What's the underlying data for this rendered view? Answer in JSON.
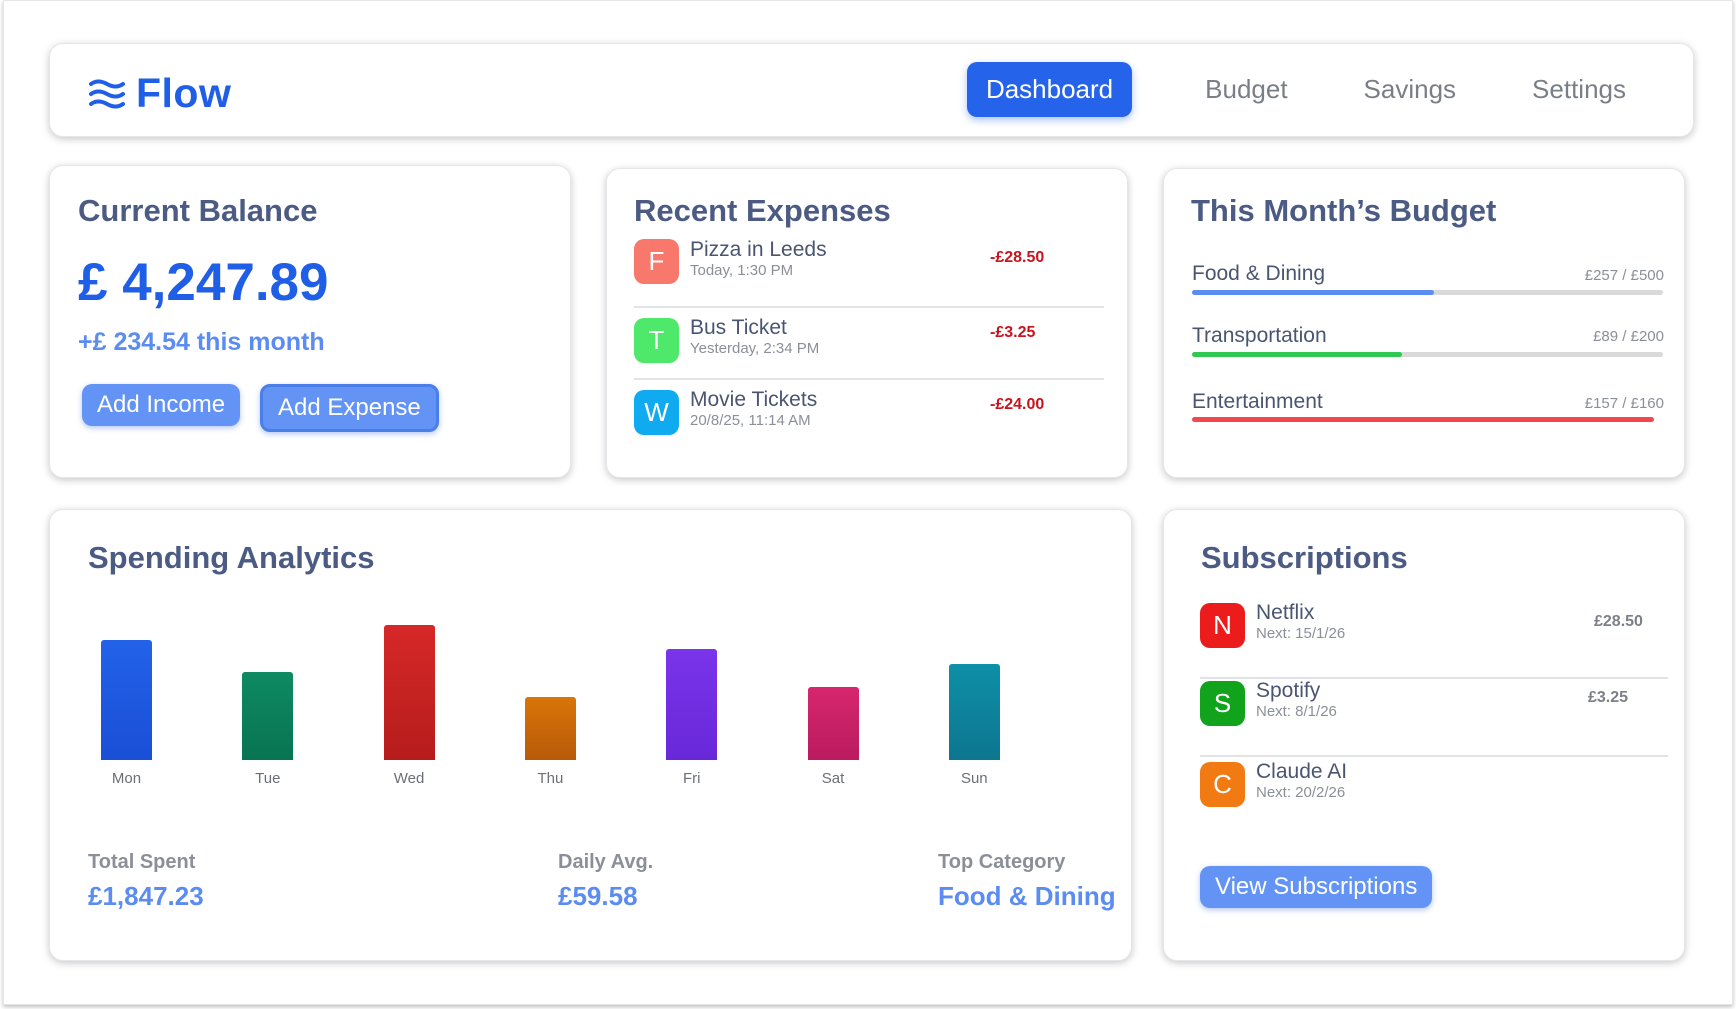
{
  "app": {
    "name": "Flow"
  },
  "nav": {
    "items": [
      {
        "label": "Dashboard",
        "active": true
      },
      {
        "label": "Budget",
        "active": false
      },
      {
        "label": "Savings",
        "active": false
      },
      {
        "label": "Settings",
        "active": false
      }
    ]
  },
  "balance": {
    "title": "Current Balance",
    "amount": "£ 4,247.89",
    "change": "+£ 234.54 this month",
    "add_income_label": "Add Income",
    "add_expense_label": "Add Expense"
  },
  "expenses": {
    "title": "Recent Expenses",
    "items": [
      {
        "initial": "F",
        "name": "Pizza in Leeds",
        "time": "Today, 1:30 PM",
        "amount": "-£28.50",
        "color": "#f8796b"
      },
      {
        "initial": "T",
        "name": "Bus Ticket",
        "time": "Yesterday, 2:34 PM",
        "amount": "-£3.25",
        "color": "#4ee86a"
      },
      {
        "initial": "W",
        "name": "Movie Tickets",
        "time": "20/8/25, 11:14 AM",
        "amount": "-£24.00",
        "color": "#10aaf0"
      }
    ]
  },
  "budget": {
    "title": "This Month’s Budget",
    "items": [
      {
        "label": "Food & Dining",
        "value": "£257 / £500",
        "fraction": 0.514,
        "color": "#5b8cf2"
      },
      {
        "label": "Transportation",
        "value": "£89 / £200",
        "fraction": 0.445,
        "color": "#2fc850"
      },
      {
        "label": "Entertainment",
        "value": "£157 / £160",
        "fraction": 0.98,
        "color": "#f0484e"
      }
    ]
  },
  "analytics": {
    "title": "Spending Analytics",
    "total_label": "Total Spent",
    "total_value": "£1,847.23",
    "avg_label": "Daily Avg.",
    "avg_value": "£59.58",
    "top_label": "Top Category",
    "top_value": "Food & Dining"
  },
  "chart_data": {
    "type": "bar",
    "categories": [
      "Mon",
      "Tue",
      "Wed",
      "Thu",
      "Fri",
      "Sat",
      "Sun"
    ],
    "values": [
      89,
      65,
      100,
      47,
      82,
      54,
      71
    ],
    "colors": [
      [
        "#2262e9",
        "#1a4fd6"
      ],
      [
        "#0e8a62",
        "#087452"
      ],
      [
        "#d62828",
        "#b61c1c"
      ],
      [
        "#d97508",
        "#b85a0a"
      ],
      [
        "#7a34ea",
        "#6828d8"
      ],
      [
        "#d6266e",
        "#bb1b5f"
      ],
      [
        "#0f8fa8",
        "#0d7690"
      ]
    ],
    "ylim": [
      0,
      100
    ]
  },
  "subscriptions": {
    "title": "Subscriptions",
    "items": [
      {
        "initial": "N",
        "name": "Netflix",
        "next": "Next: 15/1/26",
        "amount": "£28.50",
        "color": "#ec1c1c"
      },
      {
        "initial": "S",
        "name": "Spotify",
        "next": "Next: 8/1/26",
        "amount": "£3.25",
        "color": "#11a31c"
      },
      {
        "initial": "C",
        "name": "Claude AI",
        "next": "Next: 20/2/26",
        "amount": "",
        "color": "#f27a12"
      }
    ],
    "view_label": "View Subscriptions"
  }
}
